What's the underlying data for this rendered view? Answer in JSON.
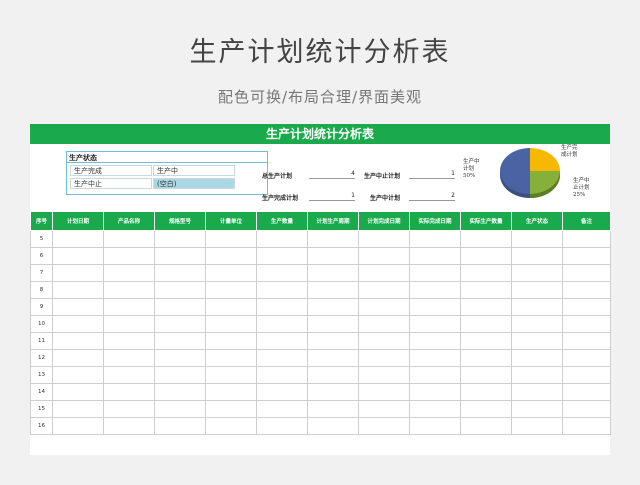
{
  "page": {
    "title": "生产计划统计分析表",
    "subtitle": "配色可换/布局合理/界面美观"
  },
  "sheet": {
    "banner": "生产计划统计分析表",
    "status_pivot": {
      "title": "生产状态",
      "rows": [
        [
          "生产完成",
          "生产中"
        ],
        [
          "生产中止",
          "(空白)"
        ]
      ]
    },
    "stats": {
      "total_plan_label": "总生产计划",
      "total_plan_value": "4",
      "completed_label": "生产完成计划",
      "completed_value": "1",
      "halted_label": "生产中止计划",
      "halted_value": "1",
      "in_progress_label": "生产中计划",
      "in_progress_value": "2"
    },
    "pie": {
      "labels": {
        "in_progress": "生产中\n计划\n50%",
        "completed": "生产完\n成计划",
        "halted": "生产中\n止计划\n25%"
      },
      "colors": {
        "in_progress": "#3f5590",
        "completed": "#f2b400",
        "halted": "#7ea72d"
      },
      "slices_percent": [
        {
          "name": "in_progress",
          "value": 50
        },
        {
          "name": "completed",
          "value": 25
        },
        {
          "name": "halted",
          "value": 25
        }
      ]
    },
    "columns": [
      "序号",
      "计划日期",
      "产品名称",
      "规格型号",
      "计量单位",
      "生产数量",
      "计划生产周期",
      "计划完成日期",
      "实际完成日期",
      "实际生产数量",
      "生产状态",
      "备注"
    ],
    "row_numbers": [
      "5",
      "6",
      "7",
      "8",
      "9",
      "10",
      "11",
      "12",
      "13",
      "14",
      "15",
      "16"
    ]
  },
  "colors": {
    "accent": "#1aaa4b",
    "background": "#f1f1f1"
  }
}
